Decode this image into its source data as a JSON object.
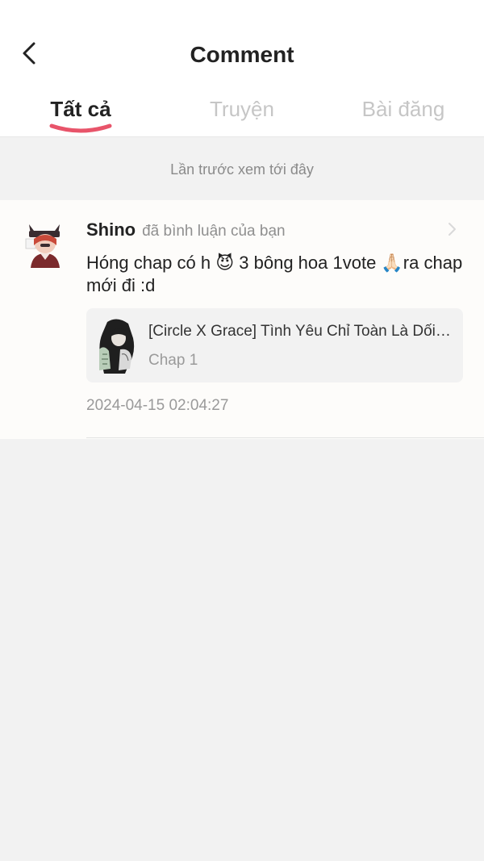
{
  "header": {
    "title": "Comment",
    "back_icon": "chevron-left-icon"
  },
  "tabs": [
    {
      "label": "Tất cả",
      "active": true
    },
    {
      "label": "Truyện",
      "active": false
    },
    {
      "label": "Bài đăng",
      "active": false
    }
  ],
  "last_seen": "Lần trước xem tới đây",
  "comments": [
    {
      "username": "Shino",
      "action": "đã bình luận của bạn",
      "text": "Hóng chap có h 😈 3 bông hoa 1vote 🙏🏻ra chap mới đi :d",
      "story": {
        "title": "[Circle X Grace] Tình Yêu Chỉ Toàn Là Dối Trá",
        "chapter": "Chap 1"
      },
      "timestamp": "2024-04-15 02:04:27"
    }
  ],
  "colors": {
    "accent": "#e8546a",
    "text_primary": "#222222",
    "text_secondary": "#8f8f8f",
    "tab_inactive": "#c6c6c6",
    "background": "#f2f2f2"
  }
}
